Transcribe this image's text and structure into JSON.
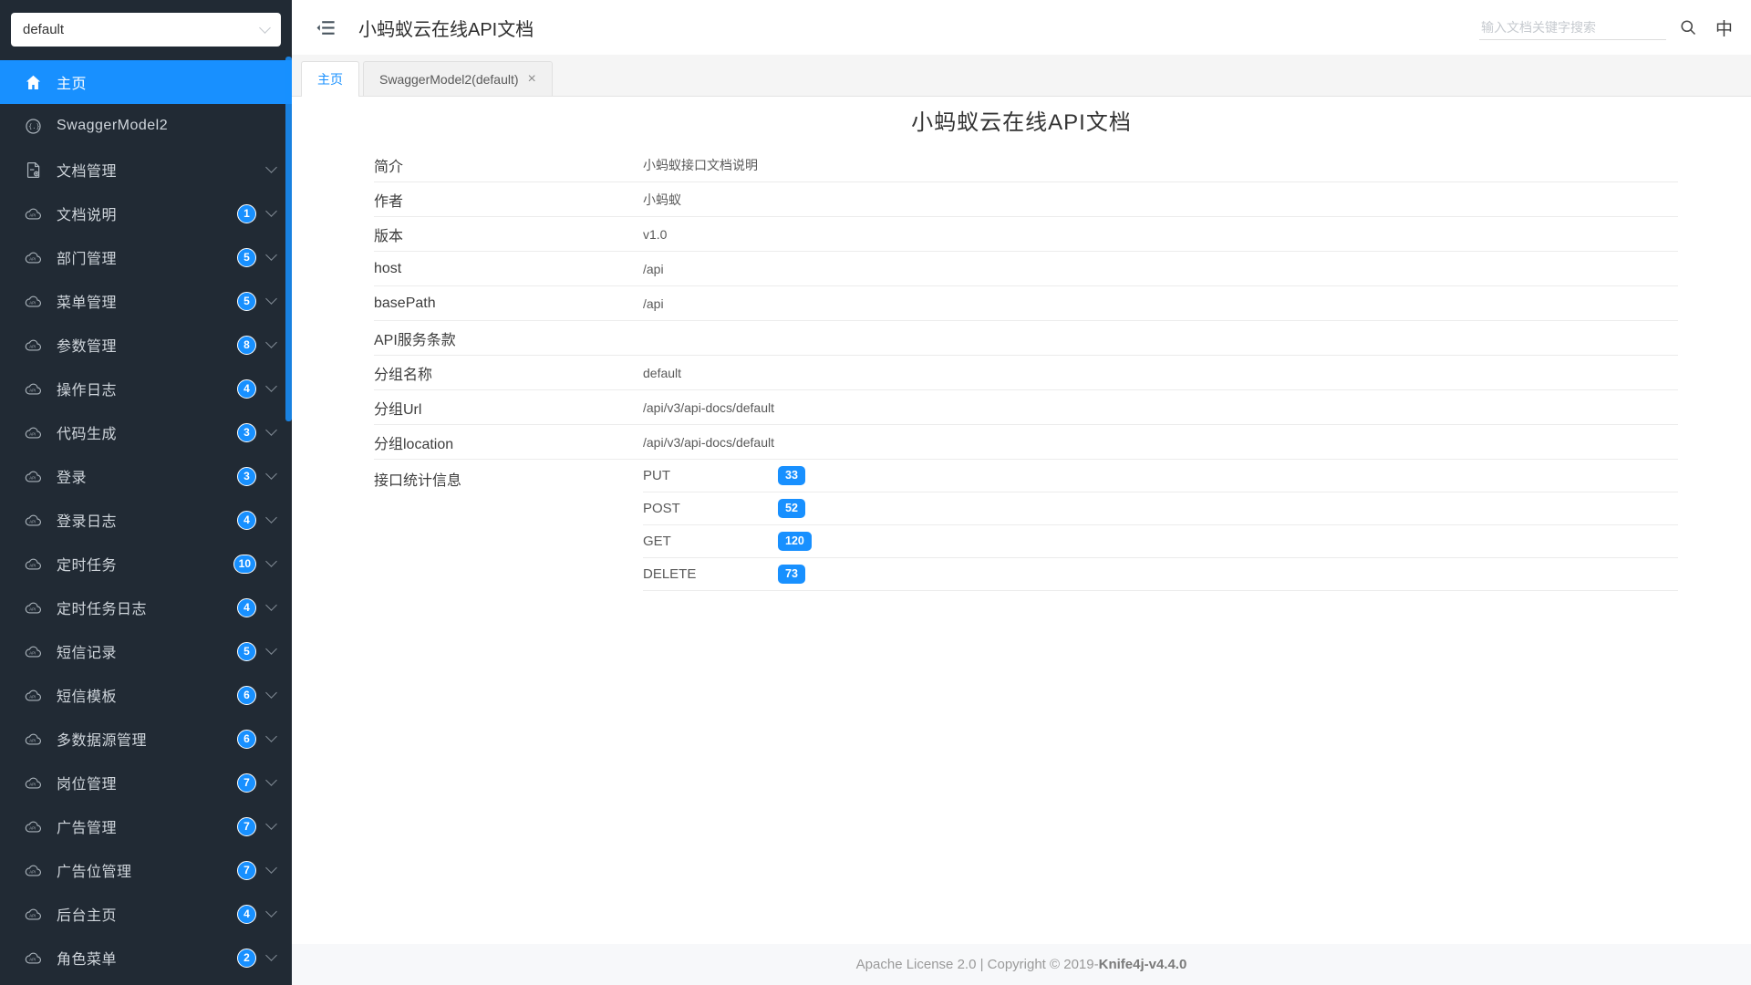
{
  "colors": {
    "accent": "#1890ff",
    "sidebar_bg": "#212a34",
    "badge": "#1890ff"
  },
  "sidebar": {
    "group_select": {
      "value": "default"
    },
    "items": [
      {
        "id": "home",
        "label": "主页",
        "icon": "home-icon",
        "active": true
      },
      {
        "id": "swagger-model2",
        "label": "SwaggerModel2",
        "icon": "swagger-icon"
      },
      {
        "id": "doc-manage",
        "label": "文档管理",
        "icon": "doc-settings-icon",
        "expandable": true
      },
      {
        "id": "doc-desc",
        "label": "文档说明",
        "icon": "api-cloud-icon",
        "badge": "1",
        "expandable": true
      },
      {
        "id": "dept-manage",
        "label": "部门管理",
        "icon": "api-cloud-icon",
        "badge": "5",
        "expandable": true
      },
      {
        "id": "menu-manage",
        "label": "菜单管理",
        "icon": "api-cloud-icon",
        "badge": "5",
        "expandable": true
      },
      {
        "id": "param-manage",
        "label": "参数管理",
        "icon": "api-cloud-icon",
        "badge": "8",
        "expandable": true
      },
      {
        "id": "operation-log",
        "label": "操作日志",
        "icon": "api-cloud-icon",
        "badge": "4",
        "expandable": true
      },
      {
        "id": "code-gen",
        "label": "代码生成",
        "icon": "api-cloud-icon",
        "badge": "3",
        "expandable": true
      },
      {
        "id": "login",
        "label": "登录",
        "icon": "api-cloud-icon",
        "badge": "3",
        "expandable": true
      },
      {
        "id": "login-log",
        "label": "登录日志",
        "icon": "api-cloud-icon",
        "badge": "4",
        "expandable": true
      },
      {
        "id": "cron-job",
        "label": "定时任务",
        "icon": "api-cloud-icon",
        "badge": "10",
        "expandable": true
      },
      {
        "id": "cron-job-log",
        "label": "定时任务日志",
        "icon": "api-cloud-icon",
        "badge": "4",
        "expandable": true
      },
      {
        "id": "sms-record",
        "label": "短信记录",
        "icon": "api-cloud-icon",
        "badge": "5",
        "expandable": true
      },
      {
        "id": "sms-template",
        "label": "短信模板",
        "icon": "api-cloud-icon",
        "badge": "6",
        "expandable": true
      },
      {
        "id": "multi-datasource",
        "label": "多数据源管理",
        "icon": "api-cloud-icon",
        "badge": "6",
        "expandable": true
      },
      {
        "id": "post-manage",
        "label": "岗位管理",
        "icon": "api-cloud-icon",
        "badge": "7",
        "expandable": true
      },
      {
        "id": "ad-manage",
        "label": "广告管理",
        "icon": "api-cloud-icon",
        "badge": "7",
        "expandable": true
      },
      {
        "id": "ad-slot-manage",
        "label": "广告位管理",
        "icon": "api-cloud-icon",
        "badge": "7",
        "expandable": true
      },
      {
        "id": "admin-home",
        "label": "后台主页",
        "icon": "api-cloud-icon",
        "badge": "4",
        "expandable": true
      },
      {
        "id": "role-menu",
        "label": "角色菜单",
        "icon": "api-cloud-icon",
        "badge": "2",
        "expandable": true
      }
    ]
  },
  "header": {
    "title": "小蚂蚁云在线API文档",
    "search_placeholder": "输入文档关键字搜索",
    "lang_label": "中"
  },
  "tabs": [
    {
      "id": "tab-home",
      "label": "主页",
      "active": true
    },
    {
      "id": "tab-swagger-model2-default",
      "label": "SwaggerModel2(default)",
      "closable": true,
      "close_glyph": "×"
    }
  ],
  "document": {
    "title": "小蚂蚁云在线API文档",
    "rows": [
      {
        "label": "简介",
        "value": "小蚂蚁接口文档说明"
      },
      {
        "label": "作者",
        "value": "小蚂蚁"
      },
      {
        "label": "版本",
        "value": "v1.0"
      },
      {
        "label": "host",
        "value": "/api"
      },
      {
        "label": "basePath",
        "value": "/api"
      },
      {
        "label": "API服务条款",
        "value": ""
      },
      {
        "label": "分组名称",
        "value": "default"
      },
      {
        "label": "分组Url",
        "value": "/api/v3/api-docs/default"
      },
      {
        "label": "分组location",
        "value": "/api/v3/api-docs/default"
      }
    ],
    "stats": {
      "label": "接口统计信息",
      "methods": [
        {
          "name": "PUT",
          "count": "33"
        },
        {
          "name": "POST",
          "count": "52"
        },
        {
          "name": "GET",
          "count": "120"
        },
        {
          "name": "DELETE",
          "count": "73"
        }
      ]
    }
  },
  "footer": {
    "text_prefix": "Apache License 2.0 | Copyright © 2019-",
    "brand": "Knife4j-v4.4.0"
  }
}
